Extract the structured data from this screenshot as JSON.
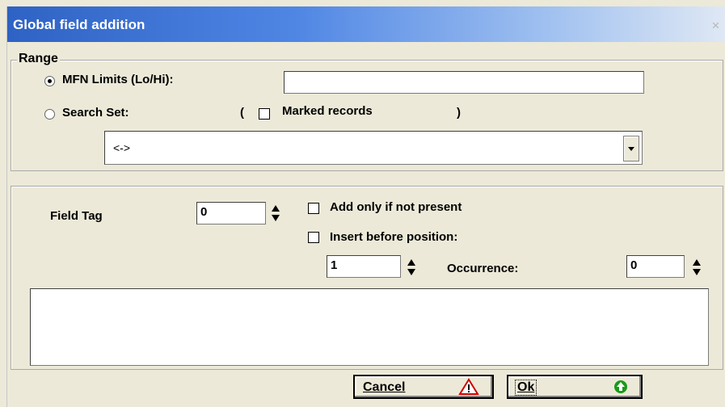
{
  "window": {
    "title": "Global field addition",
    "close_glyph": "×"
  },
  "range": {
    "label": "Range",
    "mfn_label": "MFN Limits (Lo/Hi):",
    "mfn_value": "",
    "mfn_selected": true,
    "search_label": "Search Set:",
    "search_selected": false,
    "marked_open": "(",
    "marked_label": "Marked records",
    "marked_close": ")",
    "marked_checked": false,
    "search_value": "<->"
  },
  "field": {
    "tag_label": "Field Tag",
    "tag_value": "0",
    "add_only_label": "Add only if not present",
    "insert_before_label": "Insert before position:",
    "position_value": "1",
    "occurrence_label": "Occurrence:",
    "occurrence_value": "0",
    "content": ""
  },
  "buttons": {
    "cancel_label": "Cancel",
    "cancel_icon": "warning-icon",
    "ok_label": "Ok",
    "ok_icon": "up-arrow-circle-icon"
  },
  "colors": {
    "titlebar": "#2e62c4",
    "ok_icon": "#1a9a1a",
    "warning_icon": "#d00000"
  }
}
